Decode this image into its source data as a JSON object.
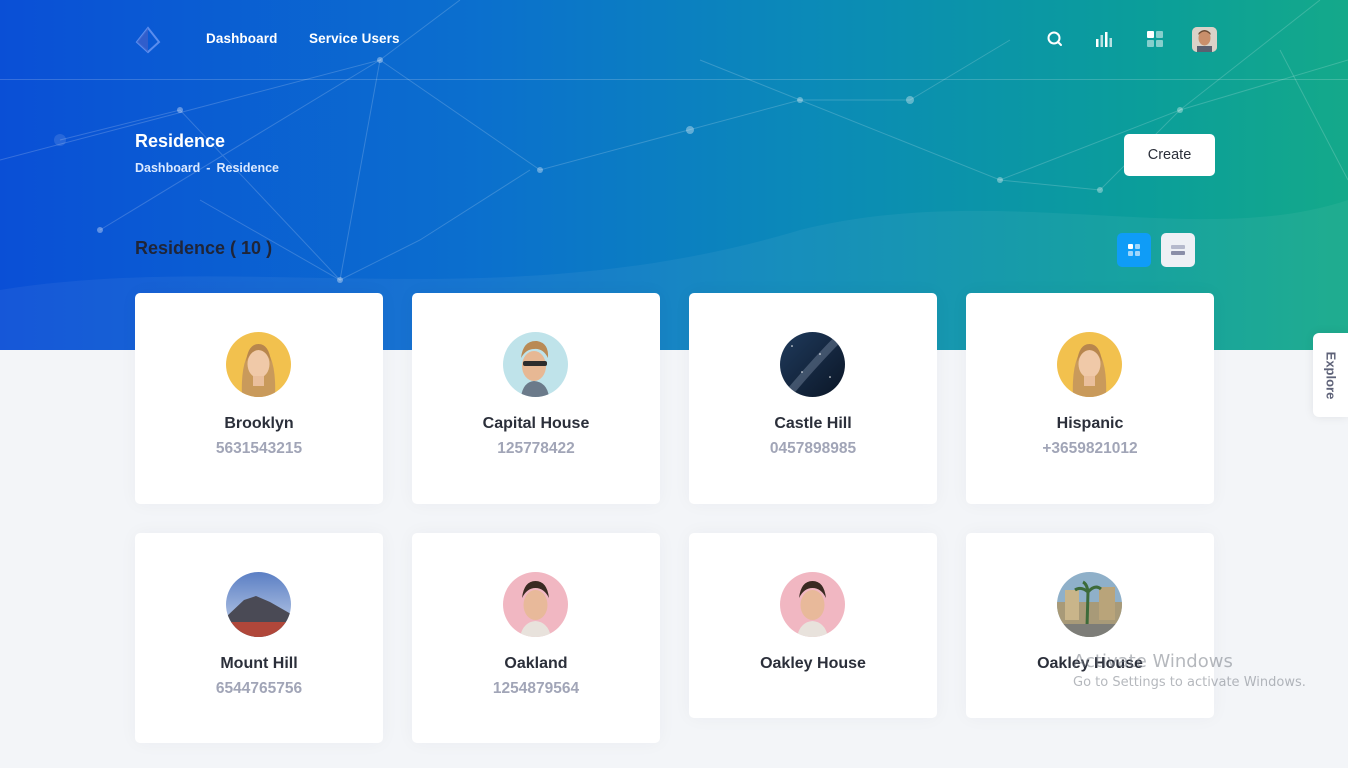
{
  "nav": {
    "dashboard": "Dashboard",
    "service_users": "Service Users"
  },
  "header": {
    "title": "Residence",
    "breadcrumb": [
      "Dashboard",
      "-",
      "Residence"
    ],
    "create_label": "Create"
  },
  "section": {
    "title": "Residence ( 10 )"
  },
  "explore_label": "Explore",
  "cards": [
    {
      "name": "Brooklyn",
      "phone": "5631543215",
      "image": "woman-blonde-portrait"
    },
    {
      "name": "Capital House",
      "phone": "125778422",
      "image": "man-sunglasses-portrait"
    },
    {
      "name": "Castle Hill",
      "phone": "0457898985",
      "image": "night-sky"
    },
    {
      "name": "Hispanic",
      "phone": "+3659821012",
      "image": "woman-blonde-portrait"
    },
    {
      "name": "Mount Hill",
      "phone": "6544765756",
      "image": "mountain-landscape"
    },
    {
      "name": "Oakland",
      "phone": "1254879564",
      "image": "man-portrait-pink"
    },
    {
      "name": "Oakley House",
      "phone": "",
      "image": "man-portrait-pink"
    },
    {
      "name": "Oakley House",
      "phone": "",
      "image": "palm-street"
    }
  ],
  "watermark": {
    "line1": "Activate Windows",
    "line2": "Go to Settings to activate Windows."
  },
  "colors": {
    "accent": "#0f9cf7",
    "gradient_start": "#0a4fd6",
    "gradient_end": "#14a98a"
  },
  "icons": [
    "logo-icon",
    "search-icon",
    "chart-icon",
    "grid-icon",
    "avatar",
    "grid-view-icon",
    "list-view-icon"
  ]
}
